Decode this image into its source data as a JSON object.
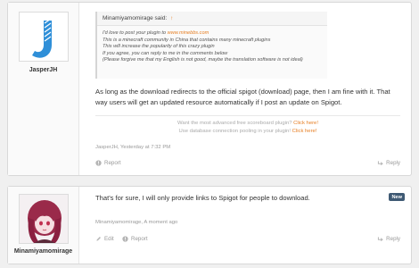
{
  "post1": {
    "username": "JasperJH",
    "quote": {
      "author_line": "Minamiyamomirage said:",
      "arrow": "↑",
      "lines": [
        "I'd love to post your plugin to ",
        "This is a minecraft community in China that contains many minecraft plugins",
        "This will increase the popularity of this crazy plugin",
        "If you agree, you can reply to me in the comments below",
        "(Please forgive me that my English is not good, maybe the translation software is not ideal)"
      ],
      "link": "www.minebbs.com"
    },
    "message_line1": "As long as the download redirects to the official spigot (download) page, then I am fine with it. That",
    "message_line2": "way users will get an updated resource automatically if I post an update on Spigot.",
    "signature": {
      "line1": "Want the most advanced free scoreboard plugin? ",
      "line1_link": "Click here!",
      "line2": "Use database connection pooling in your plugin! ",
      "line2_link": "Click here!"
    },
    "meta": "JasperJH, Yesterday at 7:32 PM",
    "actions": {
      "report": "Report",
      "reply": "Reply"
    }
  },
  "post2": {
    "username": "Minamiyamomirage",
    "badge": "New",
    "message": "That's for sure, I will only provide links to Spigot for people to download.",
    "meta": "Minamiyamomirage, A moment ago",
    "actions": {
      "edit": "Edit",
      "report": "Report",
      "reply": "Reply"
    }
  },
  "colors": {
    "accent": "#e67e22",
    "avatar_blue": "#2f8fd8",
    "badge": "#3f5a74"
  }
}
